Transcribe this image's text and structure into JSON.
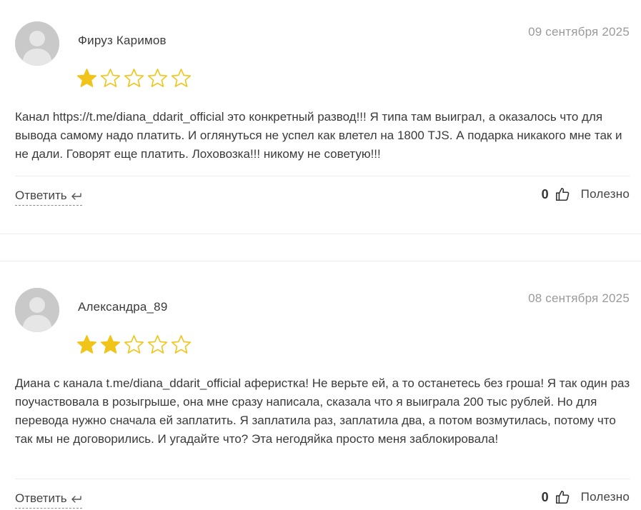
{
  "reviews": [
    {
      "author": "Фируз Каримов",
      "date": "09 сентября 2025",
      "rating": 1,
      "max_rating": 5,
      "text": "Канал https://t.me/diana_ddarit_official это конкретный развод!!! Я типа там выиграл, а оказалось что для вывода самому надо платить. И оглянуться не успел как влетел на 1800 TJS. А подарка никакого мне так и не дали. Говорят еще платить. Лоховозка!!! никому не советую!!!",
      "reply_label": "Ответить",
      "likes": "0",
      "useful_label": "Полезно"
    },
    {
      "author": "Александра_89",
      "date": "08 сентября 2025",
      "rating": 2,
      "max_rating": 5,
      "text": "Диана с канала t.me/diana_ddarit_official аферистка! Не верьте ей, а то останетесь без гроша! Я так один раз поучаствовала в розыгрыше, она мне сразу написала, сказала что я выиграла 200 тыс рублей. Но для перевода нужно сначала ей заплатить. Я заплатила раз, заплатила два, а потом возмутилась, потому что так мы не договорились. И угадайте что? Эта негодяйка просто меня заблокировала!",
      "reply_label": "Ответить",
      "likes": "0",
      "useful_label": "Полезно"
    }
  ],
  "colors": {
    "star_filled": "#f0c419",
    "star_empty": "#f0c419",
    "avatar_bg": "#c4c4c4"
  },
  "icons": {
    "avatar": "user-silhouette-icon",
    "star_full": "star-filled-icon",
    "star_empty": "star-outline-icon",
    "reply": "reply-arrow-icon",
    "like": "thumbs-up-icon"
  }
}
